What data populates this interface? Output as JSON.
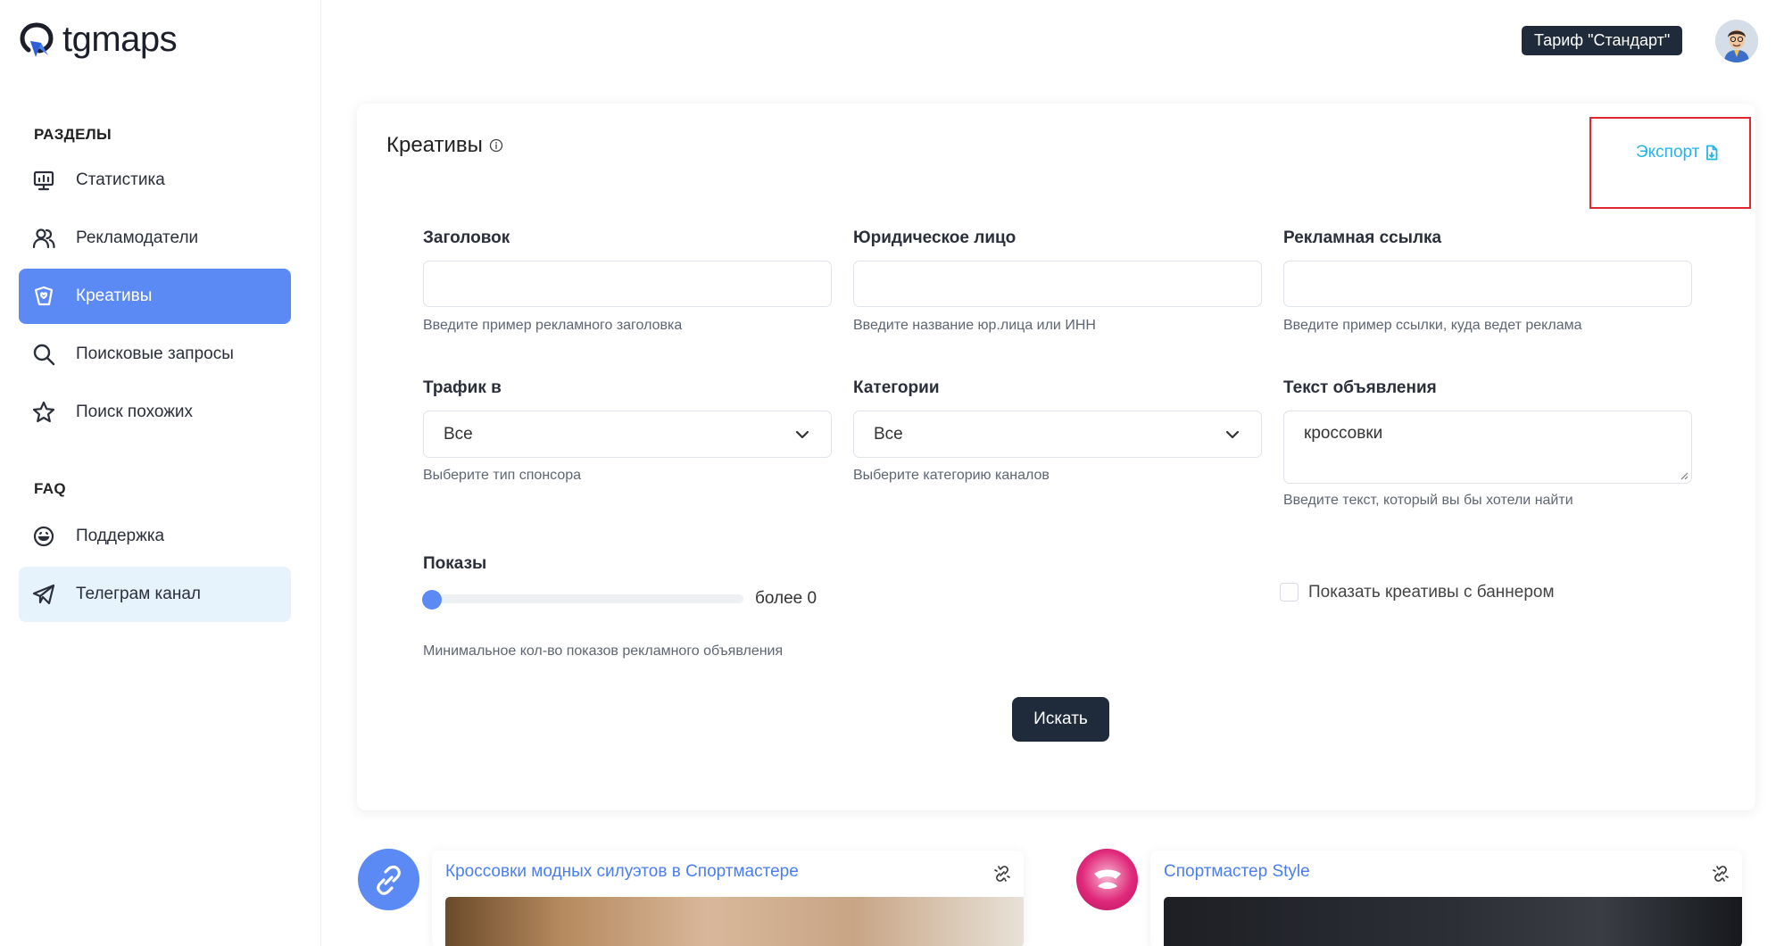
{
  "app": {
    "logo_text": "tgmaps"
  },
  "sidebar": {
    "sections_title": "РАЗДЕЛЫ",
    "items": [
      {
        "label": "Статистика",
        "icon": "presentation-icon"
      },
      {
        "label": "Рекламодатели",
        "icon": "users-icon"
      },
      {
        "label": "Креативы",
        "icon": "cards-icon",
        "active": true
      },
      {
        "label": "Поисковые запросы",
        "icon": "search-icon"
      },
      {
        "label": "Поиск похожих",
        "icon": "star-icon"
      }
    ],
    "faq_title": "FAQ",
    "faq_items": [
      {
        "label": "Поддержка",
        "icon": "smile-icon"
      },
      {
        "label": "Телеграм канал",
        "icon": "send-icon"
      }
    ]
  },
  "header": {
    "tariff_label": "Тариф \"Стандарт\""
  },
  "card": {
    "title": "Креативы",
    "export_label": "Экспорт",
    "fields": {
      "headline": {
        "label": "Заголовок",
        "value": "",
        "hint": "Введите пример рекламного заголовка"
      },
      "legal_entity": {
        "label": "Юридическое лицо",
        "value": "",
        "hint": "Введите название юр.лица или ИНН"
      },
      "ad_link": {
        "label": "Рекламная ссылка",
        "value": "",
        "hint": "Введите пример ссылки, куда ведет реклама"
      },
      "traffic": {
        "label": "Трафик в",
        "selected": "Все",
        "hint": "Выберите тип спонсора"
      },
      "categories": {
        "label": "Категории",
        "selected": "Все",
        "hint": "Выберите категорию каналов"
      },
      "ad_text": {
        "label": "Текст объявления",
        "value": "кроссовки",
        "hint": "Введите текст, который вы бы хотели найти"
      },
      "impressions": {
        "label": "Показы",
        "value_text": "более 0",
        "slider_fraction": 0,
        "hint": "Минимальное кол-во показов рекламного объявления"
      },
      "banner_checkbox": {
        "label": "Показать креативы с баннером",
        "checked": false
      }
    },
    "search_button": "Искать"
  },
  "results": [
    {
      "title": "Кроссовки модных силуэтов в Спортмастере",
      "avatar_color": "#5b8af5"
    },
    {
      "title": "Спортмастер Style",
      "avatar_color": "#e0297a"
    }
  ],
  "colors": {
    "accent": "#5b8af5",
    "dark": "#1f2a3a",
    "link": "#23b5e8",
    "highlight_box": "#e0262e"
  }
}
